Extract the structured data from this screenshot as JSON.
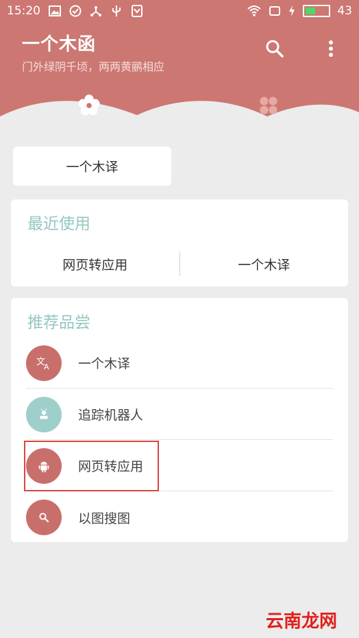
{
  "status_bar": {
    "time": "15:20",
    "battery_level": "43",
    "battery_fraction": 0.43
  },
  "header": {
    "title": "一个木函",
    "subtitle": "门外绿阴千顷，两两黄鹂相应",
    "search_icon": "search-icon",
    "more_icon": "more-vert-icon",
    "tabs": [
      {
        "icon": "flower-icon",
        "active": true
      },
      {
        "icon": "grid-icon",
        "active": false
      }
    ]
  },
  "pinned": {
    "label": "一个木译"
  },
  "recent": {
    "title": "最近使用",
    "items": [
      {
        "label": "网页转应用"
      },
      {
        "label": "一个木译"
      }
    ]
  },
  "recommend": {
    "title": "推荐品尝",
    "items": [
      {
        "label": "一个木译",
        "icon": "translate-icon",
        "color": "#c96f6b"
      },
      {
        "label": "追踪机器人",
        "icon": "robot-icon",
        "color": "#9fcfca"
      },
      {
        "label": "网页转应用",
        "icon": "android-icon",
        "color": "#c96f6b"
      },
      {
        "label": "以图搜图",
        "icon": "search-icon",
        "color": "#c96f6b"
      }
    ]
  },
  "colors": {
    "header": "#cc7772",
    "accent_title": "#93c7c2",
    "highlight_box": "#d9453f"
  },
  "watermark": "云南龙网"
}
